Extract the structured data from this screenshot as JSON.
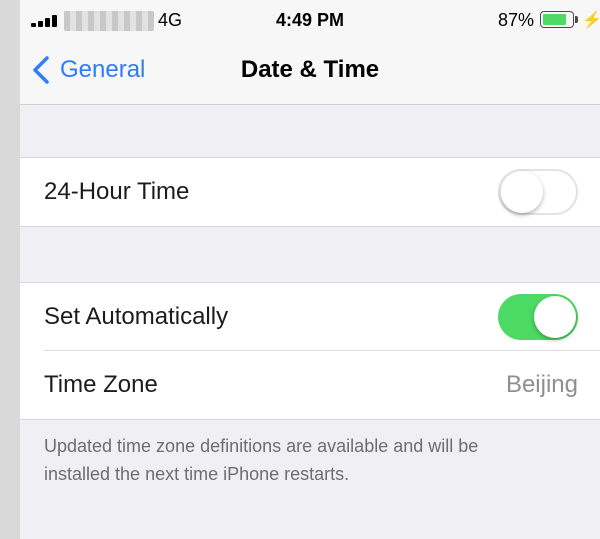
{
  "status_bar": {
    "network": "4G",
    "time": "4:49 PM",
    "battery_percent": "87%",
    "battery_level": 0.87,
    "battery_color": "#4cd964",
    "icons": [
      "signal-bars-icon",
      "battery-icon",
      "charging-bolt-icon"
    ]
  },
  "nav": {
    "back_label": "General",
    "title": "Date & Time",
    "accent_color": "#2f7cf6"
  },
  "settings": {
    "hour24": {
      "label": "24-Hour Time",
      "enabled": false
    },
    "set_automatically": {
      "label": "Set Automatically",
      "enabled": true,
      "color": "#4cd964"
    },
    "time_zone": {
      "label": "Time Zone",
      "value": "Beijing"
    }
  },
  "footer": {
    "line1": "Updated time zone definitions are available and will be",
    "line2": "installed the next time iPhone restarts."
  }
}
